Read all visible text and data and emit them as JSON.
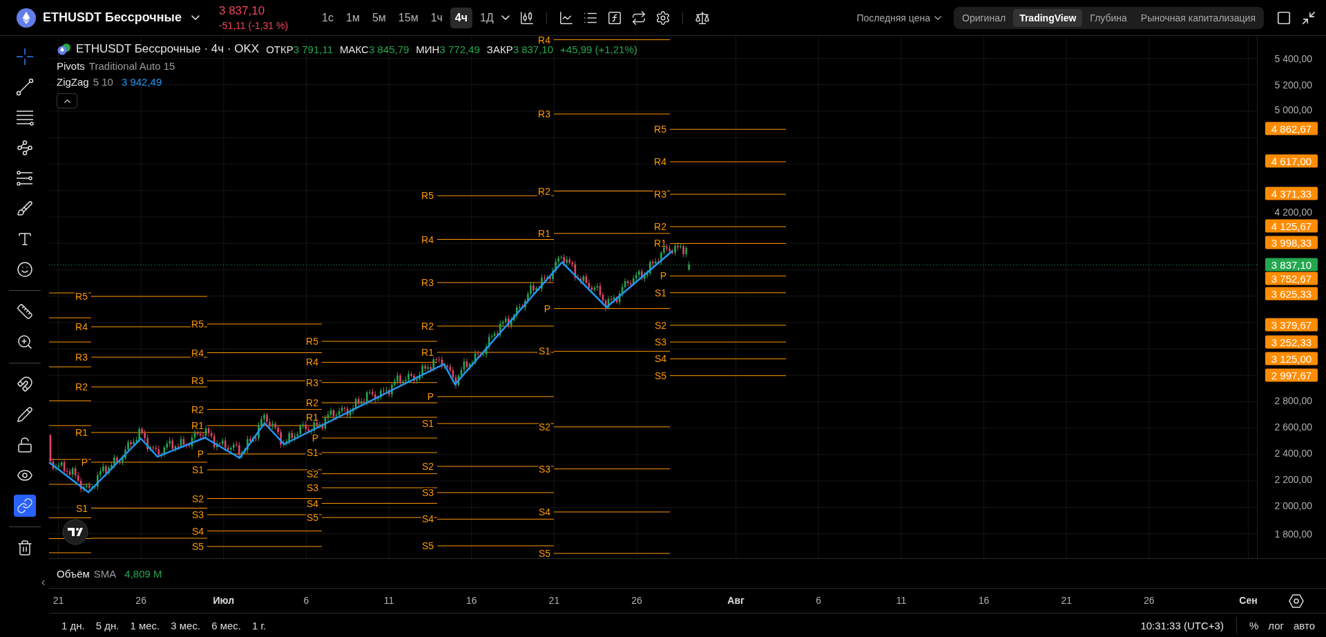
{
  "header": {
    "symbol": "ETHUSDT Бессрочные",
    "price": "3 837,10",
    "change": "-51,11 (-1,31 %)",
    "intervals": [
      {
        "label": "1с",
        "selected": false
      },
      {
        "label": "1м",
        "selected": false
      },
      {
        "label": "5м",
        "selected": false
      },
      {
        "label": "15м",
        "selected": false
      },
      {
        "label": "1ч",
        "selected": false
      },
      {
        "label": "4ч",
        "selected": true
      },
      {
        "label": "1Д",
        "selected": false
      }
    ],
    "price_source": "Последняя цена",
    "views": [
      {
        "label": "Оригинал",
        "selected": false
      },
      {
        "label": "TradingView",
        "selected": true
      },
      {
        "label": "Глубина",
        "selected": false
      },
      {
        "label": "Рыночная капитализация",
        "selected": false
      }
    ]
  },
  "tools": [
    {
      "kind": "tool",
      "selected": true
    },
    {
      "kind": "tool",
      "selected": false
    },
    {
      "kind": "tool",
      "selected": false
    },
    {
      "kind": "tool",
      "selected": false
    },
    {
      "kind": "tool",
      "selected": false
    },
    {
      "kind": "tool",
      "selected": false
    },
    {
      "kind": "tool",
      "selected": false
    },
    {
      "kind": "tool",
      "selected": false
    },
    {
      "kind": "tool",
      "selected": false
    },
    {
      "kind": "tool",
      "selected": false
    },
    {
      "kind": "toggle",
      "on": false
    },
    {
      "kind": "toggle",
      "on": false
    },
    {
      "kind": "toggle",
      "on": false
    },
    {
      "kind": "toggle",
      "on": false
    },
    {
      "kind": "toggle",
      "on": true
    },
    {
      "kind": "action"
    }
  ],
  "legend": {
    "title": "ETHUSDT Бессрочные · 4ч · OKX",
    "ohlc": [
      {
        "label": "ОТКР",
        "value": "3 791,11"
      },
      {
        "label": "МАКС",
        "value": "3 845,79"
      },
      {
        "label": "МИН",
        "value": "3 772,49"
      },
      {
        "label": "ЗАКР",
        "value": "3 837,10"
      }
    ],
    "change": "+45,99 (+1,21%)",
    "indicators": [
      {
        "name": "Pivots",
        "params": "Traditional Auto 15"
      },
      {
        "name": "ZigZag",
        "params": "5 10",
        "value": "3 942,49"
      }
    ]
  },
  "pivot_periods": [
    {
      "levels": [
        "R5",
        "R4",
        "R3",
        "R2",
        "R1",
        "P",
        "S1"
      ]
    },
    {
      "levels": [
        "R5",
        "R4",
        "R3",
        "R2",
        "R1",
        "P",
        "S1",
        "S2",
        "S3",
        "S4",
        "S5"
      ]
    },
    {
      "levels": [
        "R5",
        "R4",
        "R3",
        "R2",
        "R1",
        "P",
        "S1",
        "S2",
        "S3",
        "S4",
        "S5"
      ]
    },
    {
      "levels": [
        "R5",
        "R4",
        "R3",
        "R2",
        "R1",
        "P",
        "S1",
        "S2",
        "S3",
        "S4",
        "S5"
      ]
    },
    {
      "levels": [
        "R4",
        "R3",
        "R2",
        "R1",
        "P",
        "S1",
        "S2",
        "S3",
        "S4",
        "S5"
      ]
    },
    {
      "levels": [
        "R5",
        "R4",
        "R3",
        "R2",
        "R1",
        "P",
        "S1",
        "S2",
        "S3",
        "S4",
        "S5"
      ]
    }
  ],
  "price_axis": {
    "ticks": [
      "5 400,00",
      "5 200,00",
      "5 000,00",
      "4 200,00",
      "2 800,00",
      "2 600,00",
      "2 400,00",
      "2 200,00",
      "2 000,00",
      "1 800,00"
    ],
    "badges": [
      {
        "label": "4 862,67",
        "color": "#ff8c00"
      },
      {
        "label": "4 617,00",
        "color": "#ff8c00"
      },
      {
        "label": "4 371,33",
        "color": "#ff8c00"
      },
      {
        "label": "4 125,67",
        "color": "#ff8c00"
      },
      {
        "label": "3 998,33",
        "color": "#ff8c00"
      },
      {
        "label": "3 837,10",
        "color": "#25a750"
      },
      {
        "label": "3 752,67",
        "color": "#ff8c00"
      },
      {
        "label": "3 625,33",
        "color": "#ff8c00"
      },
      {
        "label": "3 379,67",
        "color": "#ff8c00"
      },
      {
        "label": "3 252,33",
        "color": "#ff8c00"
      },
      {
        "label": "3 125,00",
        "color": "#ff8c00"
      },
      {
        "label": "2 997,67",
        "color": "#ff8c00"
      }
    ]
  },
  "volume": {
    "name": "Объём",
    "ma": "SMA",
    "value": "4,809 M"
  },
  "time_axis": [
    {
      "label": "21",
      "kind": "day"
    },
    {
      "label": "26",
      "kind": "day"
    },
    {
      "label": "Июл",
      "kind": "month"
    },
    {
      "label": "6",
      "kind": "day"
    },
    {
      "label": "11",
      "kind": "day"
    },
    {
      "label": "16",
      "kind": "day"
    },
    {
      "label": "21",
      "kind": "day"
    },
    {
      "label": "26",
      "kind": "day"
    },
    {
      "label": "Авг",
      "kind": "month"
    },
    {
      "label": "6",
      "kind": "day"
    },
    {
      "label": "11",
      "kind": "day"
    },
    {
      "label": "16",
      "kind": "day"
    },
    {
      "label": "21",
      "kind": "day"
    },
    {
      "label": "26",
      "kind": "day"
    },
    {
      "label": "Сен",
      "kind": "month"
    }
  ],
  "ranges": [
    "1 дн.",
    "5 дн.",
    "1 мес.",
    "3 мес.",
    "6 мес.",
    "1 г."
  ],
  "status": {
    "time": "10:31:33 (UTC+3)",
    "options": [
      "%",
      "лог",
      "авто"
    ]
  }
}
